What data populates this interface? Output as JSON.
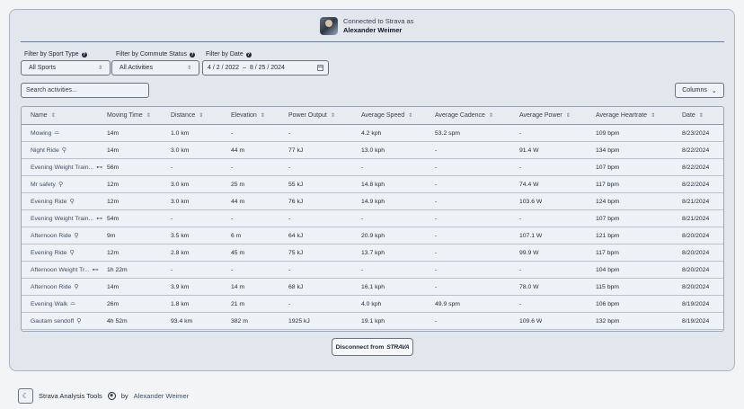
{
  "connection": {
    "status": "Connected to Strava as",
    "user": "Alexander Weimer"
  },
  "filters": {
    "sport_label": "Filter by Sport Type",
    "sport_value": "All Sports",
    "commute_label": "Filter by Commute Status",
    "commute_value": "All Activities",
    "date_label": "Filter by Date",
    "date_start": "4 / 2 / 2022",
    "date_sep": "–",
    "date_end": "8 / 25 / 2024"
  },
  "search": {
    "placeholder": "Search activities..."
  },
  "columns_button": "Columns",
  "table": {
    "headers": [
      "Name",
      "Moving Time",
      "Distance",
      "Elevation",
      "Power Output",
      "Average Speed",
      "Average Cadence",
      "Average Power",
      "Average Heartrate",
      "Date"
    ],
    "rows": [
      {
        "name": "Mowing",
        "icon": "shoe-icon",
        "time": "14m",
        "dist": "1.0 km",
        "elev": "-",
        "power": "-",
        "speed": "4.2 kph",
        "cad": "53.2 spm",
        "avgp": "-",
        "hr": "109 bpm",
        "date": "8/23/2024"
      },
      {
        "name": "Night Ride",
        "icon": "bike-icon",
        "time": "14m",
        "dist": "3.0 km",
        "elev": "44 m",
        "power": "77 kJ",
        "speed": "13.0 kph",
        "cad": "-",
        "avgp": "91.4 W",
        "hr": "134 bpm",
        "date": "8/22/2024"
      },
      {
        "name": "Evening Weight Train...",
        "icon": "dumbbell-icon",
        "time": "56m",
        "dist": "-",
        "elev": "-",
        "power": "-",
        "speed": "-",
        "cad": "-",
        "avgp": "-",
        "hr": "107 bpm",
        "date": "8/22/2024"
      },
      {
        "name": "Mr safety",
        "icon": "bike-icon",
        "time": "12m",
        "dist": "3.0 km",
        "elev": "25 m",
        "power": "55 kJ",
        "speed": "14.8 kph",
        "cad": "-",
        "avgp": "74.4 W",
        "hr": "117 bpm",
        "date": "8/22/2024"
      },
      {
        "name": "Evening Ride",
        "icon": "bike-icon",
        "time": "12m",
        "dist": "3.0 km",
        "elev": "44 m",
        "power": "76 kJ",
        "speed": "14.9 kph",
        "cad": "-",
        "avgp": "103.6 W",
        "hr": "124 bpm",
        "date": "8/21/2024"
      },
      {
        "name": "Evening Weight Train...",
        "icon": "dumbbell-icon",
        "time": "54m",
        "dist": "-",
        "elev": "-",
        "power": "-",
        "speed": "-",
        "cad": "-",
        "avgp": "-",
        "hr": "107 bpm",
        "date": "8/21/2024"
      },
      {
        "name": "Afternoon Ride",
        "icon": "bike-icon",
        "time": "9m",
        "dist": "3.5 km",
        "elev": "6 m",
        "power": "64 kJ",
        "speed": "20.9 kph",
        "cad": "-",
        "avgp": "107.1 W",
        "hr": "121 bpm",
        "date": "8/20/2024"
      },
      {
        "name": "Evening Ride",
        "icon": "bike-icon",
        "time": "12m",
        "dist": "2.8 km",
        "elev": "45 m",
        "power": "75 kJ",
        "speed": "13.7 kph",
        "cad": "-",
        "avgp": "99.9 W",
        "hr": "117 bpm",
        "date": "8/20/2024"
      },
      {
        "name": "Afternoon Weight Tr...",
        "icon": "dumbbell-icon",
        "time": "1h 22m",
        "dist": "-",
        "elev": "-",
        "power": "-",
        "speed": "-",
        "cad": "-",
        "avgp": "-",
        "hr": "104 bpm",
        "date": "8/20/2024"
      },
      {
        "name": "Afternoon Ride",
        "icon": "bike-icon",
        "time": "14m",
        "dist": "3.9 km",
        "elev": "14 m",
        "power": "68 kJ",
        "speed": "16.1 kph",
        "cad": "-",
        "avgp": "78.0 W",
        "hr": "115 bpm",
        "date": "8/20/2024"
      },
      {
        "name": "Evening Walk",
        "icon": "shoe-icon",
        "time": "26m",
        "dist": "1.8 km",
        "elev": "21 m",
        "power": "-",
        "speed": "4.0 kph",
        "cad": "49.9 spm",
        "avgp": "-",
        "hr": "106 bpm",
        "date": "8/19/2024"
      },
      {
        "name": "Gautam sendoff",
        "icon": "bike-icon",
        "time": "4h 52m",
        "dist": "93.4 km",
        "elev": "382 m",
        "power": "1925 kJ",
        "speed": "19.1 kph",
        "cad": "-",
        "avgp": "109.6 W",
        "hr": "132 bpm",
        "date": "8/19/2024"
      }
    ]
  },
  "disconnect": {
    "label": "Disconnect from",
    "brand": "STRAVA"
  },
  "footer": {
    "app": "Strava Analysis Tools",
    "by": "by",
    "author": "Alexander Weimer"
  }
}
